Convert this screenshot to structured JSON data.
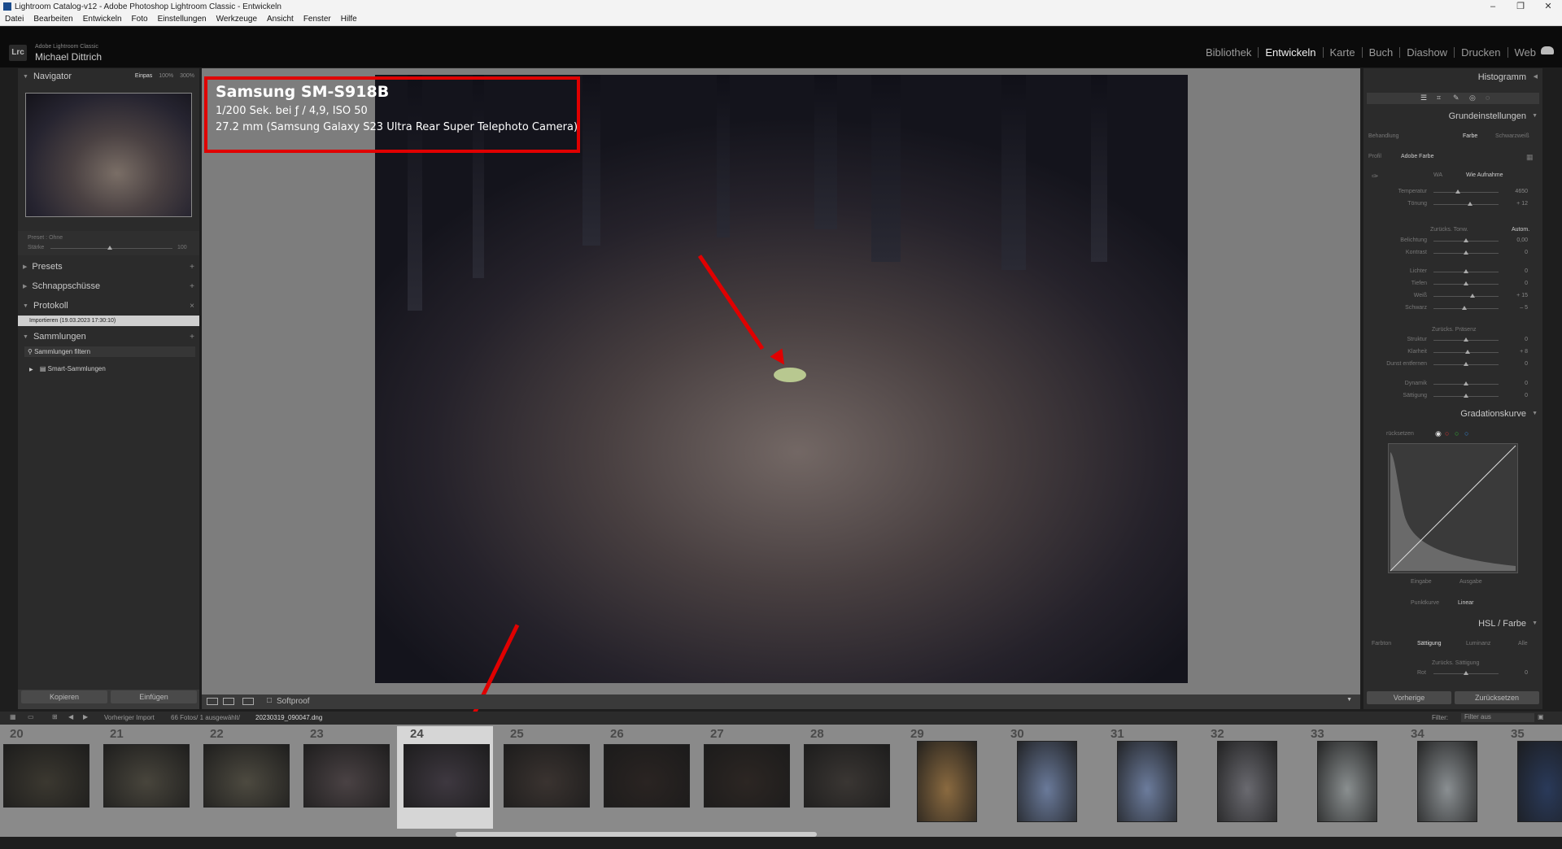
{
  "window": {
    "title": "Lightroom Catalog-v12 - Adobe Photoshop Lightroom Classic - Entwickeln",
    "controls": [
      "–",
      "❐",
      "✕"
    ]
  },
  "menu": [
    "Datei",
    "Bearbeiten",
    "Entwickeln",
    "Foto",
    "Einstellungen",
    "Werkzeuge",
    "Ansicht",
    "Fenster",
    "Hilfe"
  ],
  "identity": {
    "logo": "Lrc",
    "product": "Adobe Lightroom Classic",
    "user": "Michael Dittrich"
  },
  "modules": [
    {
      "label": "Bibliothek",
      "active": false
    },
    {
      "label": "Entwickeln",
      "active": true
    },
    {
      "label": "Karte",
      "active": false
    },
    {
      "label": "Buch",
      "active": false
    },
    {
      "label": "Diashow",
      "active": false
    },
    {
      "label": "Drucken",
      "active": false
    },
    {
      "label": "Web",
      "active": false
    }
  ],
  "left": {
    "navigator": "Navigator",
    "zoom": [
      "Einpas",
      "100%",
      "300%"
    ],
    "preset_label": "Preset : Ohne",
    "strength_label": "Stärke",
    "strength_value": "100",
    "presets": "Presets",
    "snapshots": "Schnappschüsse",
    "history": "Protokoll",
    "history_item": "Importieren (19.03.2023 17:30:10)",
    "collections": "Sammlungen",
    "coll_filter": "Sammlungen filtern",
    "coll_smart": "Smart-Sammlungen",
    "copy": "Kopieren",
    "paste": "Einfügen"
  },
  "exif": {
    "camera": "Samsung SM-S918B",
    "line1": "1/200 Sek. bei ƒ / 4,9, ISO 50",
    "line2": "27.2 mm (Samsung Galaxy S23 Ultra Rear Super Telephoto Camera)"
  },
  "toolbar": {
    "softproof": "Softproof"
  },
  "right": {
    "histogram": "Histogramm",
    "basic": "Grundeinstellungen",
    "treatment": "Behandlung",
    "treatment_color": "Farbe",
    "treatment_bw": "Schwarzweiß",
    "profile_label": "Profil",
    "profile_value": "Adobe Farbe",
    "wb_label": "WA",
    "wb_value": "Wie Aufnahme",
    "tone_reset": "Zurücks. Tonw.",
    "auto": "Autom.",
    "presence_reset": "Zurücks. Präsenz",
    "sliders_wb": [
      {
        "label": "Temperatur",
        "value": "4650",
        "pos": 0.38
      },
      {
        "label": "Tönung",
        "value": "+ 12",
        "pos": 0.56
      }
    ],
    "sliders_tone": [
      {
        "label": "Belichtung",
        "value": "0,00",
        "pos": 0.5
      },
      {
        "label": "Kontrast",
        "value": "0",
        "pos": 0.5
      }
    ],
    "sliders_tone2": [
      {
        "label": "Lichter",
        "value": "0",
        "pos": 0.5
      },
      {
        "label": "Tiefen",
        "value": "0",
        "pos": 0.5
      },
      {
        "label": "Weiß",
        "value": "+ 15",
        "pos": 0.6
      },
      {
        "label": "Schwarz",
        "value": "– 5",
        "pos": 0.47
      }
    ],
    "sliders_presence": [
      {
        "label": "Struktur",
        "value": "0",
        "pos": 0.5
      },
      {
        "label": "Klarheit",
        "value": "+ 8",
        "pos": 0.53
      },
      {
        "label": "Dunst entfernen",
        "value": "0",
        "pos": 0.5
      }
    ],
    "sliders_presence2": [
      {
        "label": "Dynamik",
        "value": "0",
        "pos": 0.5
      },
      {
        "label": "Sättigung",
        "value": "0",
        "pos": 0.5
      }
    ],
    "curve": "Gradationskurve",
    "curve_reset": "rücksetzen",
    "curve_input": "Eingabe",
    "curve_output": "Ausgabe",
    "pointcurve_label": "Punktkurve",
    "pointcurve_value": "Linear",
    "hsl": "HSL / Farbe",
    "hsl_tabs": [
      "Farbton",
      "Sättigung",
      "Luminanz",
      "Alle"
    ],
    "hsl_reset": "Zurücks. Sättigung",
    "hsl_red": "Rot",
    "hsl_red_value": "0",
    "prev": "Vorherige",
    "reset": "Zurücksetzen"
  },
  "filmbar": {
    "source": "Vorheriger Import",
    "count": "66 Fotos/ 1 ausgewählt/",
    "filename": "20230319_090047.dng",
    "filter_label": "Filter:",
    "filter_value": "Filter aus"
  },
  "film": [
    {
      "num": "20",
      "tone": "#3b3830"
    },
    {
      "num": "21",
      "tone": "#48453c"
    },
    {
      "num": "22",
      "tone": "#4d4a40"
    },
    {
      "num": "23",
      "tone": "#4a4244"
    },
    {
      "num": "24",
      "tone": "#3e3840",
      "selected": true
    },
    {
      "num": "25",
      "tone": "#3a3330"
    },
    {
      "num": "26",
      "tone": "#2a2422"
    },
    {
      "num": "27",
      "tone": "#2c2623"
    },
    {
      "num": "28",
      "tone": "#3a3633"
    },
    {
      "num": "29",
      "tone": "#8a6a40",
      "portrait": true
    },
    {
      "num": "30",
      "tone": "#6a7a9a",
      "portrait": true
    },
    {
      "num": "31",
      "tone": "#6c7c9c",
      "portrait": true
    },
    {
      "num": "32",
      "tone": "#6a6a70",
      "portrait": true
    },
    {
      "num": "33",
      "tone": "#8a8f90",
      "portrait": true
    },
    {
      "num": "34",
      "tone": "#8a8f92",
      "portrait": true
    },
    {
      "num": "35",
      "tone": "#2a3a5a",
      "portrait": true
    }
  ]
}
